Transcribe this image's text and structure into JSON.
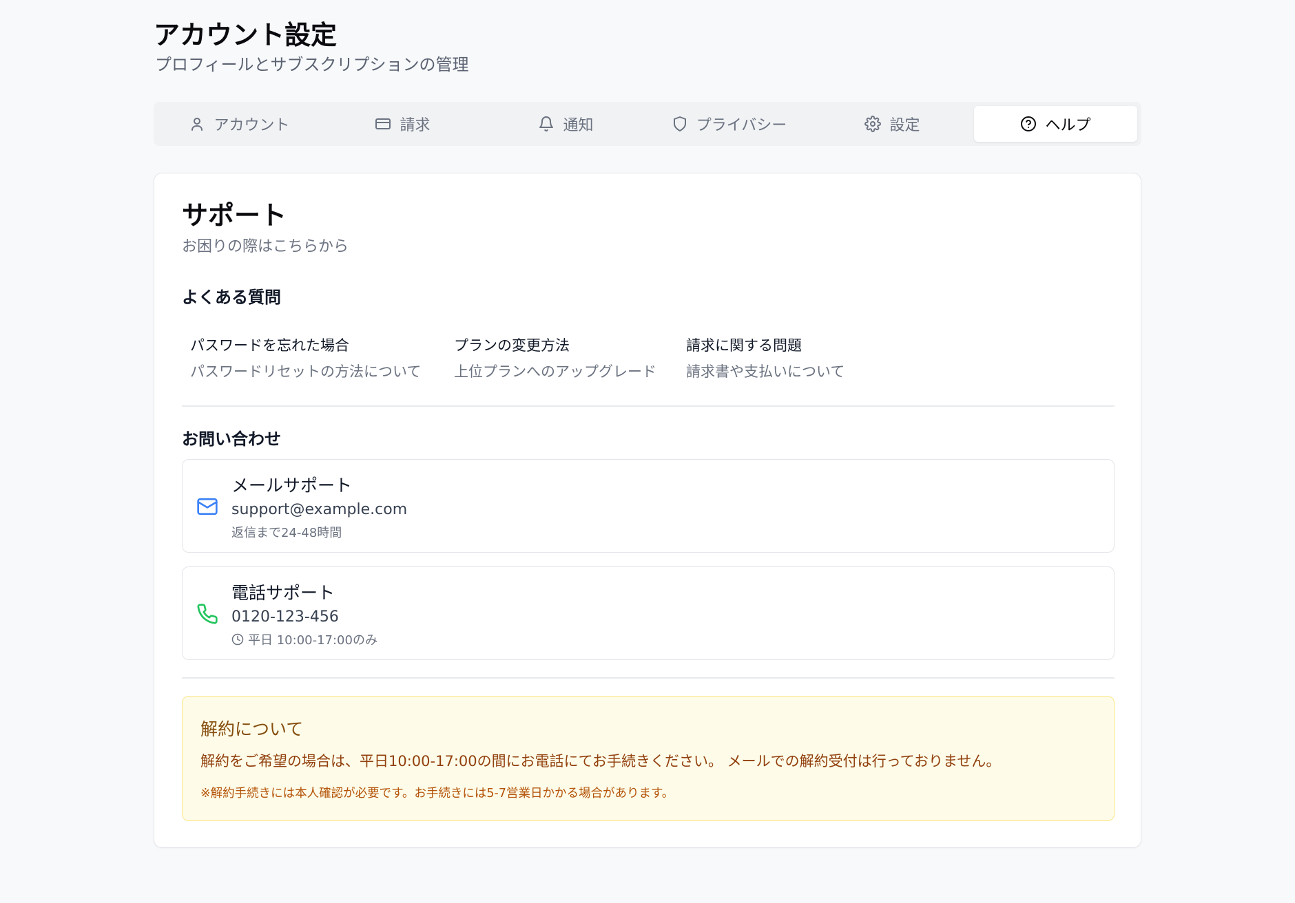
{
  "header": {
    "title": "アカウント設定",
    "subtitle": "プロフィールとサブスクリプションの管理"
  },
  "tabs": [
    {
      "label": "アカウント",
      "icon": "user-icon"
    },
    {
      "label": "請求",
      "icon": "credit-card-icon"
    },
    {
      "label": "通知",
      "icon": "bell-icon"
    },
    {
      "label": "プライバシー",
      "icon": "shield-icon"
    },
    {
      "label": "設定",
      "icon": "gear-icon"
    },
    {
      "label": "ヘルプ",
      "icon": "help-circle-icon",
      "active": true
    }
  ],
  "support": {
    "title": "サポート",
    "description": "お困りの際はこちらから",
    "faq_title": "よくある質問",
    "faq": [
      {
        "question": "パスワードを忘れた場合",
        "answer": "パスワードリセットの方法について"
      },
      {
        "question": "プランの変更方法",
        "answer": "上位プランへのアップグレード"
      },
      {
        "question": "請求に関する問題",
        "answer": "請求書や支払いについて"
      }
    ],
    "contact_title": "お問い合わせ",
    "contacts": {
      "email": {
        "name": "メールサポート",
        "value": "support@example.com",
        "note": "返信まで24-48時間",
        "icon": "mail-icon",
        "color": "#3b82f6"
      },
      "phone": {
        "name": "電話サポート",
        "value": "0120-123-456",
        "note": "平日 10:00-17:00のみ",
        "icon": "phone-icon",
        "color": "#22c55e"
      }
    },
    "cancellation": {
      "title": "解約について",
      "body": "解約をご希望の場合は、平日10:00-17:00の間にお電話にてお手続きください。 メールでの解約受付は行っておりません。",
      "note": "※解約手続きには本人確認が必要です。お手続きには5-7営業日かかる場合があります。"
    }
  }
}
